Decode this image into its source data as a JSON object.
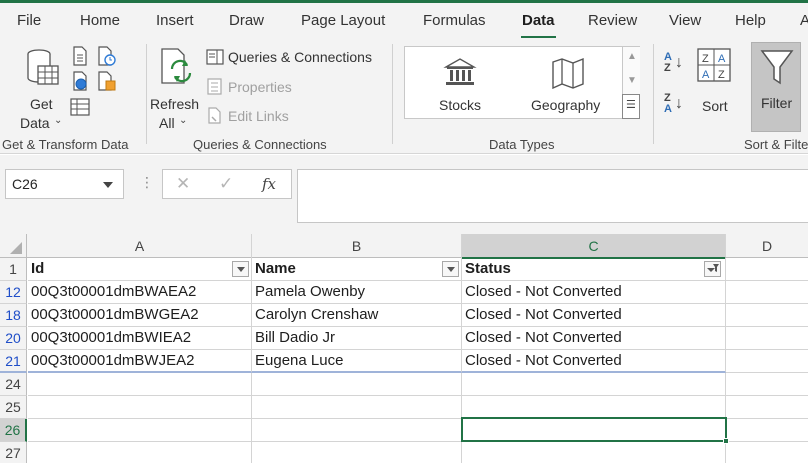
{
  "menu": {
    "tabs": [
      "File",
      "Home",
      "Insert",
      "Draw",
      "Page Layout",
      "Formulas",
      "Data",
      "Review",
      "View",
      "Help",
      "A"
    ],
    "active": "Data"
  },
  "ribbon": {
    "get_data": {
      "label_line1": "Get",
      "label_line2": "Data",
      "group": "Get & Transform Data"
    },
    "refresh": {
      "label_line1": "Refresh",
      "label_line2": "All"
    },
    "queries_connections": "Queries & Connections",
    "properties": "Properties",
    "edit_links": "Edit Links",
    "queries_group": "Queries & Connections",
    "stocks": "Stocks",
    "geography": "Geography",
    "datatypes_group": "Data Types",
    "sort": "Sort",
    "filter": "Filter",
    "sort_filter_group": "Sort & Filter",
    "az_top": "A",
    "az_bottom": "Z",
    "za_top": "Z",
    "za_bottom": "A"
  },
  "formula_bar": {
    "name_box": "C26",
    "cancel": "✕",
    "enter": "✓",
    "fx": "fx",
    "value": ""
  },
  "grid": {
    "columns": [
      "A",
      "B",
      "C",
      "D"
    ],
    "selected_column": "C",
    "header_row": {
      "row": "1",
      "cells": [
        "Id",
        "Name",
        "Status",
        ""
      ]
    },
    "rows": [
      {
        "row": "12",
        "filtered": true,
        "cells": [
          "00Q3t00001dmBWAEA2",
          "Pamela Owenby",
          "Closed - Not Converted",
          ""
        ]
      },
      {
        "row": "18",
        "filtered": true,
        "cells": [
          "00Q3t00001dmBWGEA2",
          "Carolyn Crenshaw",
          "Closed - Not Converted",
          ""
        ]
      },
      {
        "row": "20",
        "filtered": true,
        "cells": [
          "00Q3t00001dmBWIEA2",
          "Bill Dadio Jr",
          "Closed - Not Converted",
          ""
        ]
      },
      {
        "row": "21",
        "filtered": true,
        "cells": [
          "00Q3t00001dmBWJEA2",
          "Eugena Luce",
          "Closed - Not Converted",
          ""
        ]
      },
      {
        "row": "24",
        "filtered": false,
        "cells": [
          "",
          "",
          "",
          ""
        ]
      },
      {
        "row": "25",
        "filtered": false,
        "cells": [
          "",
          "",
          "",
          ""
        ]
      },
      {
        "row": "26",
        "filtered": false,
        "selected": true,
        "cells": [
          "",
          "",
          "",
          ""
        ]
      },
      {
        "row": "27",
        "filtered": false,
        "cells": [
          "",
          "",
          "",
          ""
        ]
      }
    ],
    "active_cell": "C26"
  },
  "colors": {
    "accent": "#217346",
    "filtered_row_number": "#1f4ec8",
    "ribbon_bg": "#f3f3f3"
  }
}
